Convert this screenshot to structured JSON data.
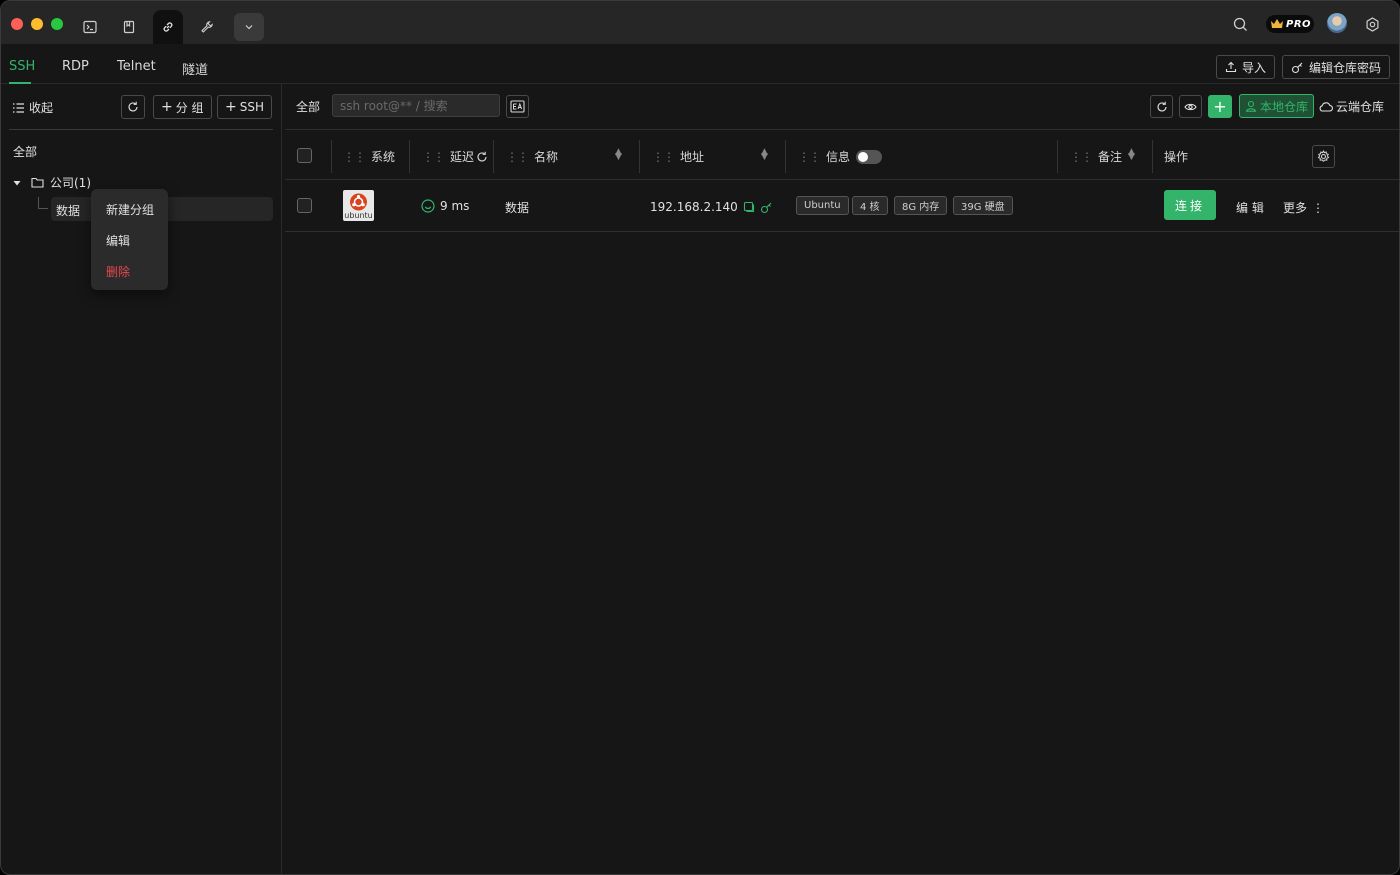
{
  "titlebar": {
    "tabs": [
      {
        "icon": "terminal-icon"
      },
      {
        "icon": "bookmark-icon"
      },
      {
        "icon": "link-icon",
        "active": true
      },
      {
        "icon": "wrench-icon"
      }
    ],
    "pro_badge": "PRO"
  },
  "protocol_tabs": {
    "items": [
      "SSH",
      "RDP",
      "Telnet",
      "隧道"
    ],
    "active": "SSH",
    "import_label": "导入",
    "edit_repo_password_label": "编辑仓库密码"
  },
  "sidebar": {
    "collapse_label": "收起",
    "add_group_label": "分 组",
    "add_ssh_label": "SSH",
    "all_label": "全部",
    "group_name": "公司(1)",
    "child_name": "数据",
    "context_menu": {
      "new_group": "新建分组",
      "edit": "编辑",
      "delete": "删除"
    }
  },
  "main": {
    "all_label": "全部",
    "search_placeholder": "ssh root@** / 搜索",
    "local_repo_label": "本地仓库",
    "cloud_repo_label": "云端仓库",
    "columns": {
      "system": "系统",
      "latency": "延迟",
      "name": "名称",
      "address": "地址",
      "info": "信息",
      "note": "备注",
      "actions": "操作"
    },
    "rows": [
      {
        "os_logo_text": "ubuntu",
        "latency": "9 ms",
        "name": "数据",
        "address": "192.168.2.140",
        "tags": [
          "Ubuntu",
          "4 核",
          "8G 内存",
          "39G 硬盘"
        ],
        "connect_label": "连接",
        "edit_label": "编 辑",
        "more_label": "更多"
      }
    ]
  },
  "colors": {
    "accent": "#34b36b",
    "danger": "#e5484d",
    "background": "#161616",
    "titlebar": "#262626"
  }
}
